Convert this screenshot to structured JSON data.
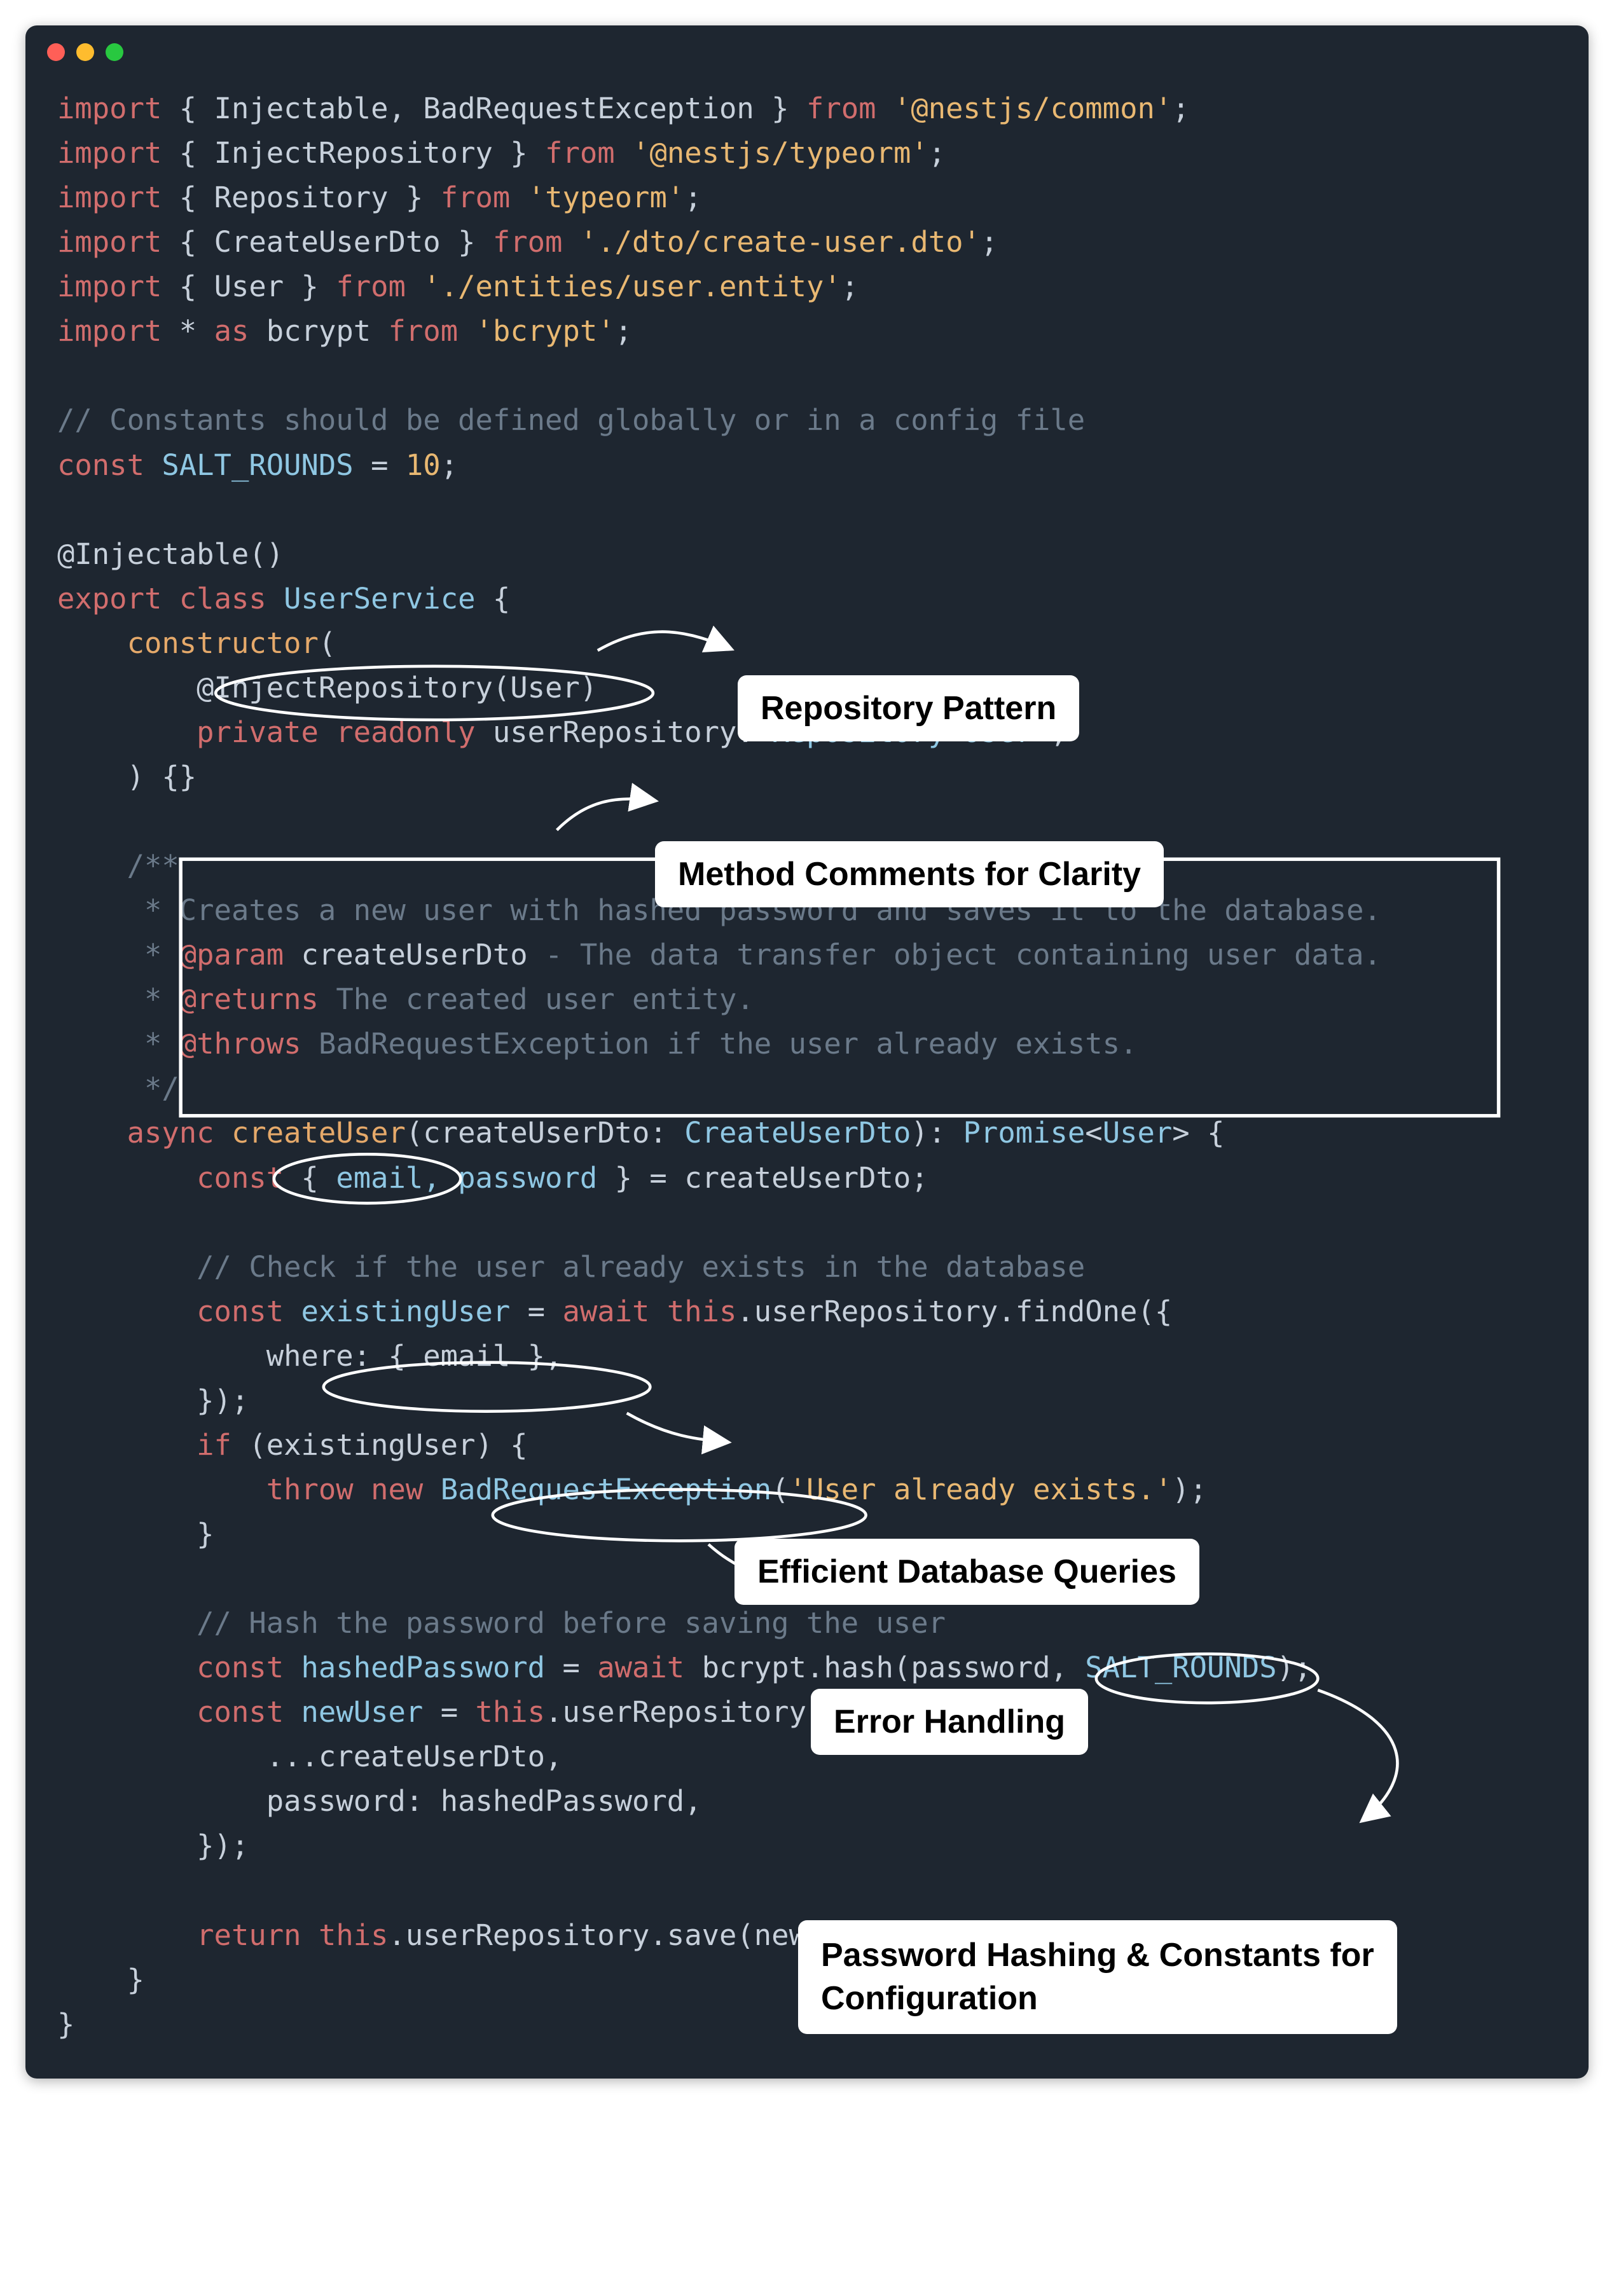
{
  "code": {
    "imports": [
      {
        "items": "Injectable, BadRequestException",
        "from": "@nestjs/common"
      },
      {
        "items": "InjectRepository",
        "from": "@nestjs/typeorm"
      },
      {
        "items": "Repository",
        "from": "typeorm"
      },
      {
        "items": "CreateUserDto",
        "from": "./dto/create-user.dto"
      },
      {
        "items": "User",
        "from": "./entities/user.entity"
      },
      {
        "star_as": "bcrypt",
        "from": "bcrypt"
      }
    ],
    "constants_comment": "// Constants should be defined globally or in a config file",
    "const_name": "SALT_ROUNDS",
    "const_value": "10",
    "decorator": "@Injectable()",
    "class_name": "UserService",
    "constructor": {
      "inject_decorator": "@InjectRepository",
      "inject_arg": "User",
      "param_name": "userRepository",
      "param_type": "Repository",
      "param_generic": "User"
    },
    "jsdoc": {
      "desc": "Creates a new user with hashed password and saves it to the database.",
      "param_name": "createUserDto",
      "param_desc": "The data transfer object containing user data.",
      "returns": "The created user entity.",
      "throws": "BadRequestException if the user already exists."
    },
    "method": {
      "name": "createUser",
      "param": "createUserDto",
      "param_type": "CreateUserDto",
      "return_type": "Promise",
      "return_generic": "User",
      "destructure": "email, password",
      "destructure_from": "createUserDto",
      "check_comment": "// Check if the user already exists in the database",
      "existing_var": "existingUser",
      "find_call": "this.userRepository.findOne",
      "where_field": "email",
      "error_class": "BadRequestException",
      "error_msg": "'User already exists.'",
      "hash_comment": "// Hash the password before saving the user",
      "hashed_var": "hashedPassword",
      "hash_call": "bcrypt.hash",
      "hash_args_a": "password",
      "hash_args_b": "SALT_ROUNDS",
      "new_user_var": "newUser",
      "create_call": "this.userRepository.create",
      "spread": "createUserDto",
      "pw_key": "password",
      "pw_val": "hashedPassword",
      "return_call": "this.userRepository.save",
      "return_arg": "newUser"
    }
  },
  "callouts": {
    "repo": "Repository Pattern",
    "comments": "Method Comments for Clarity",
    "queries": "Efficient Database Queries",
    "error": "Error Handling",
    "hash": "Password Hashing &\nConstants for Configuration"
  }
}
